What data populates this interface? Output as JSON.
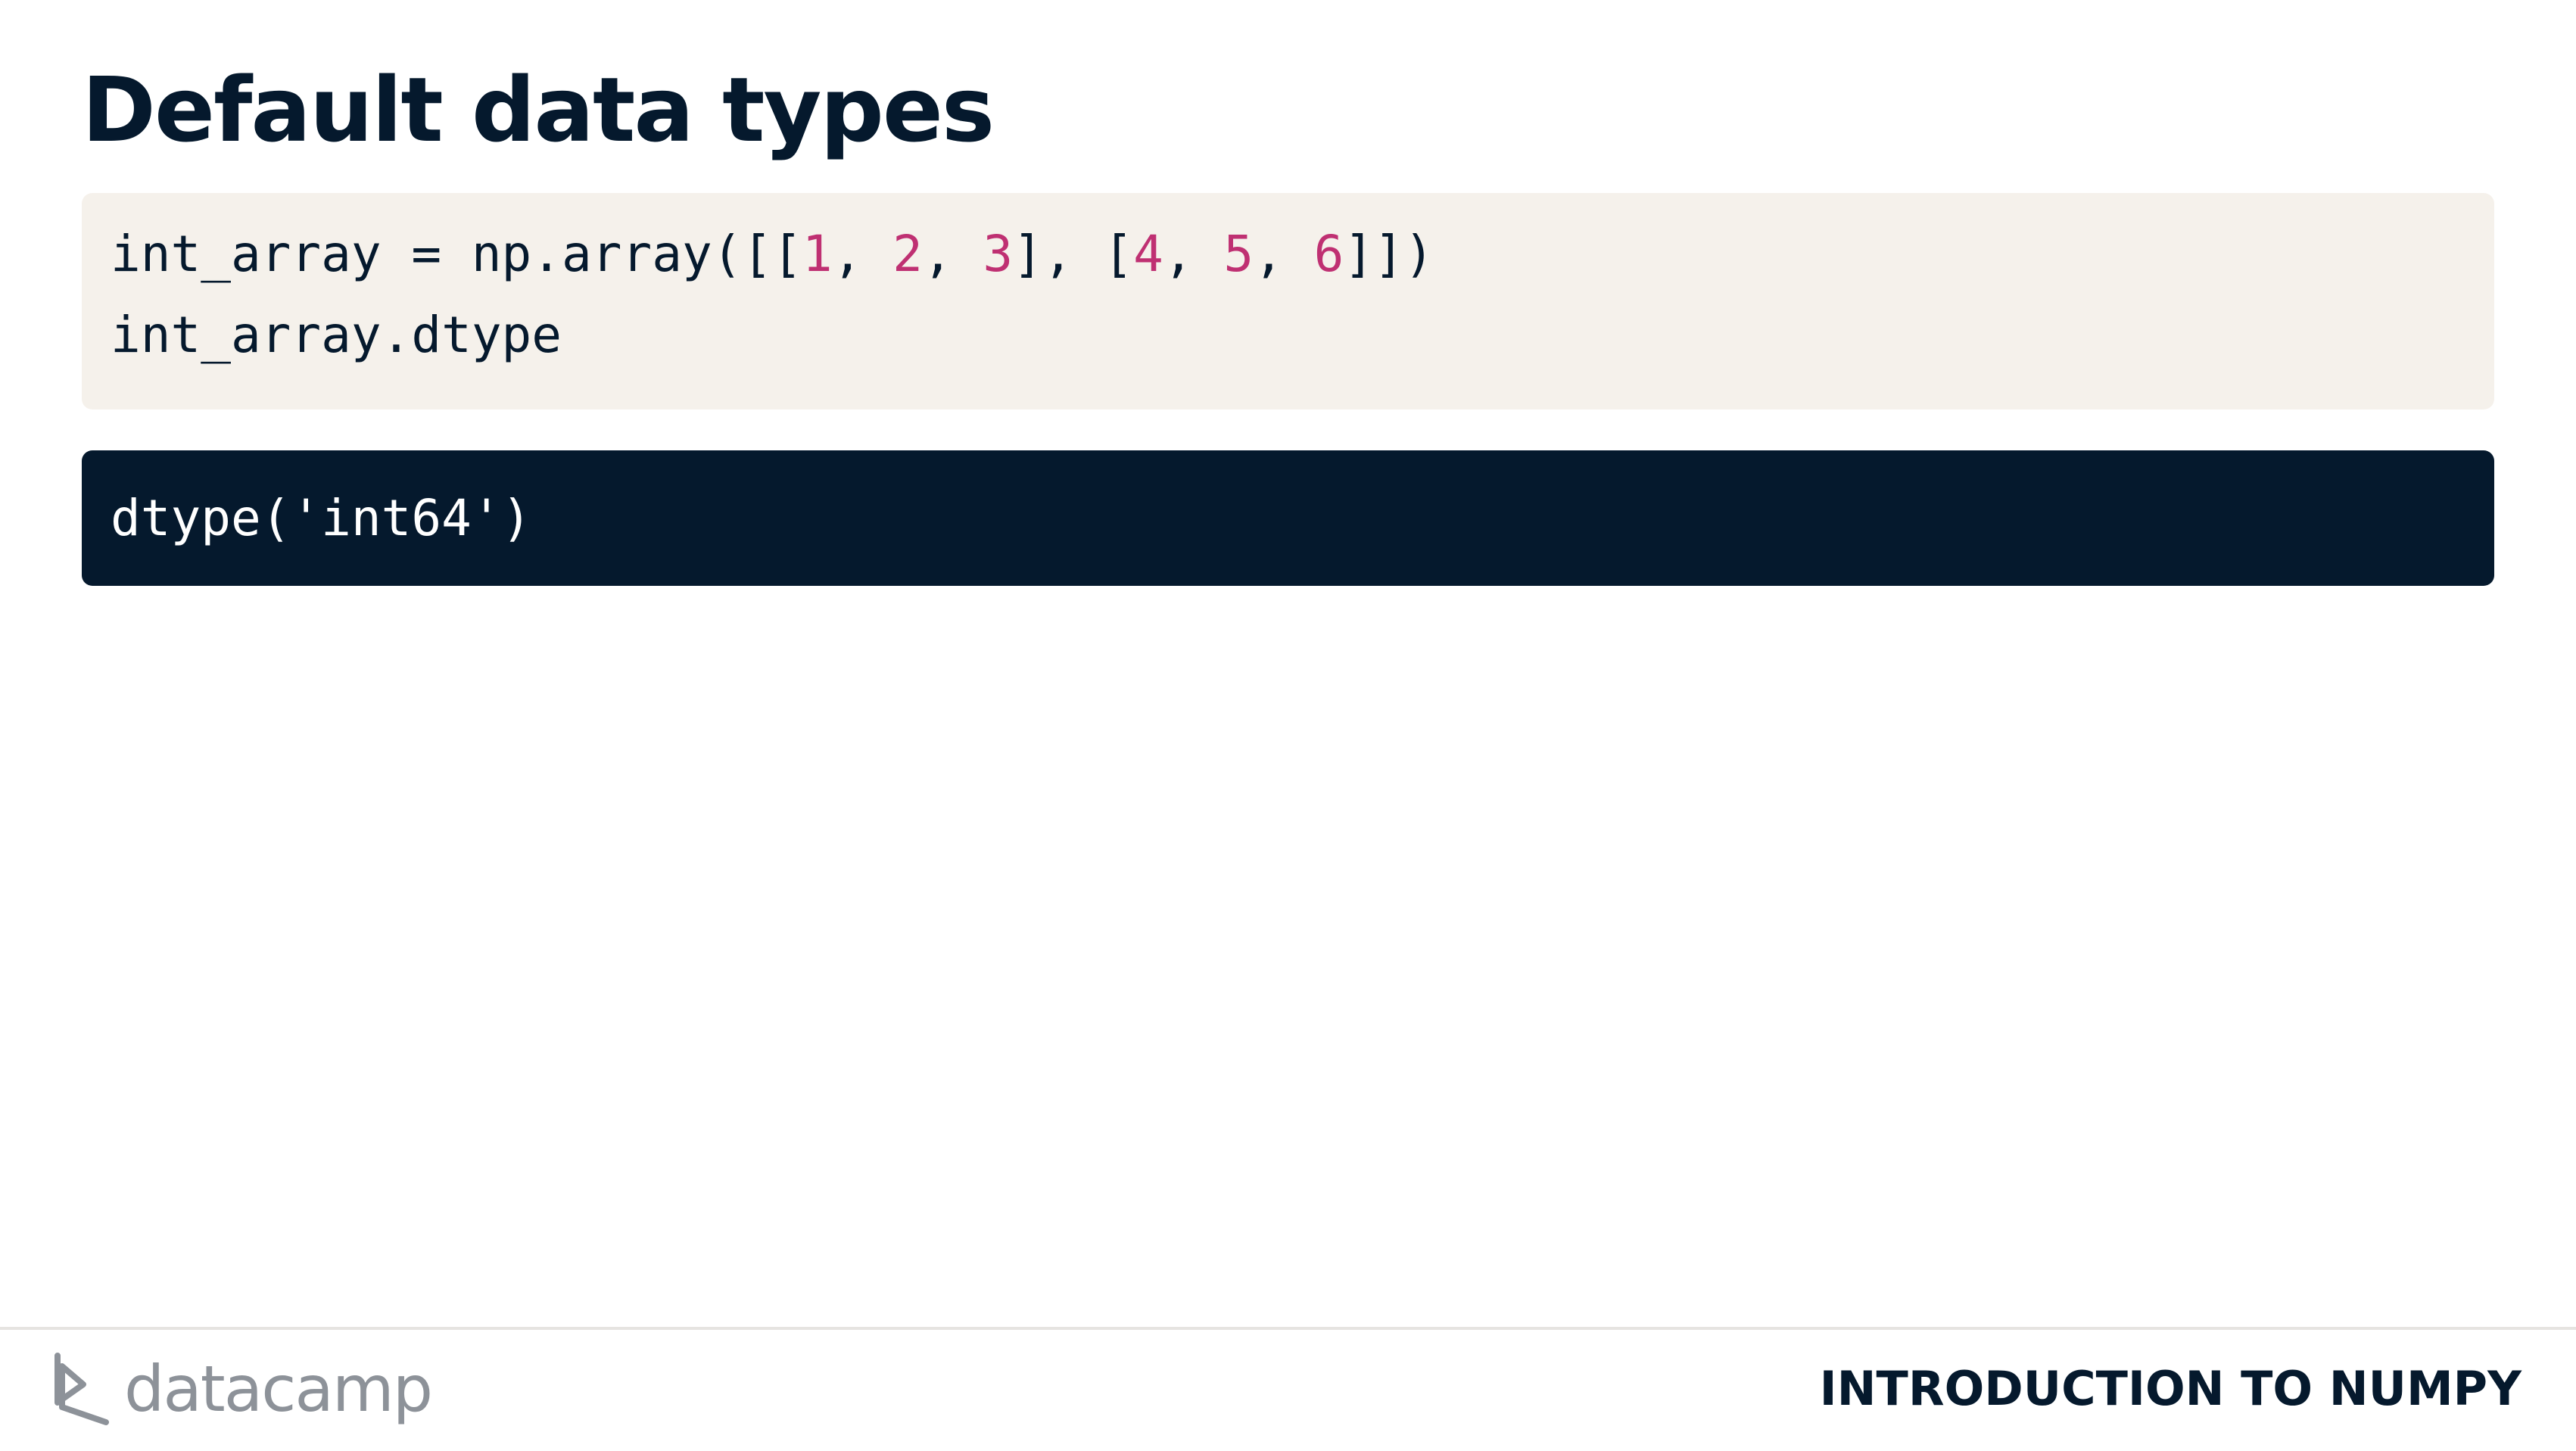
{
  "slide": {
    "title": "Default data types"
  },
  "code": {
    "line1": {
      "prefix": "int_array = np.array([[",
      "n1": "1",
      "s1": ", ",
      "n2": "2",
      "s2": ", ",
      "n3": "3",
      "s3": "], [",
      "n4": "4",
      "s4": ", ",
      "n5": "5",
      "s5": ", ",
      "n6": "6",
      "suffix": "]])"
    },
    "line2": "int_array.dtype"
  },
  "output": {
    "text": "dtype('int64')"
  },
  "footer": {
    "logo_text": "datacamp",
    "course_title": "INTRODUCTION TO NUMPY"
  },
  "colors": {
    "heading": "#05192d",
    "code_bg": "#f5f1eb",
    "output_bg": "#05192d",
    "number": "#bf3072",
    "logo": "#8d9299"
  }
}
